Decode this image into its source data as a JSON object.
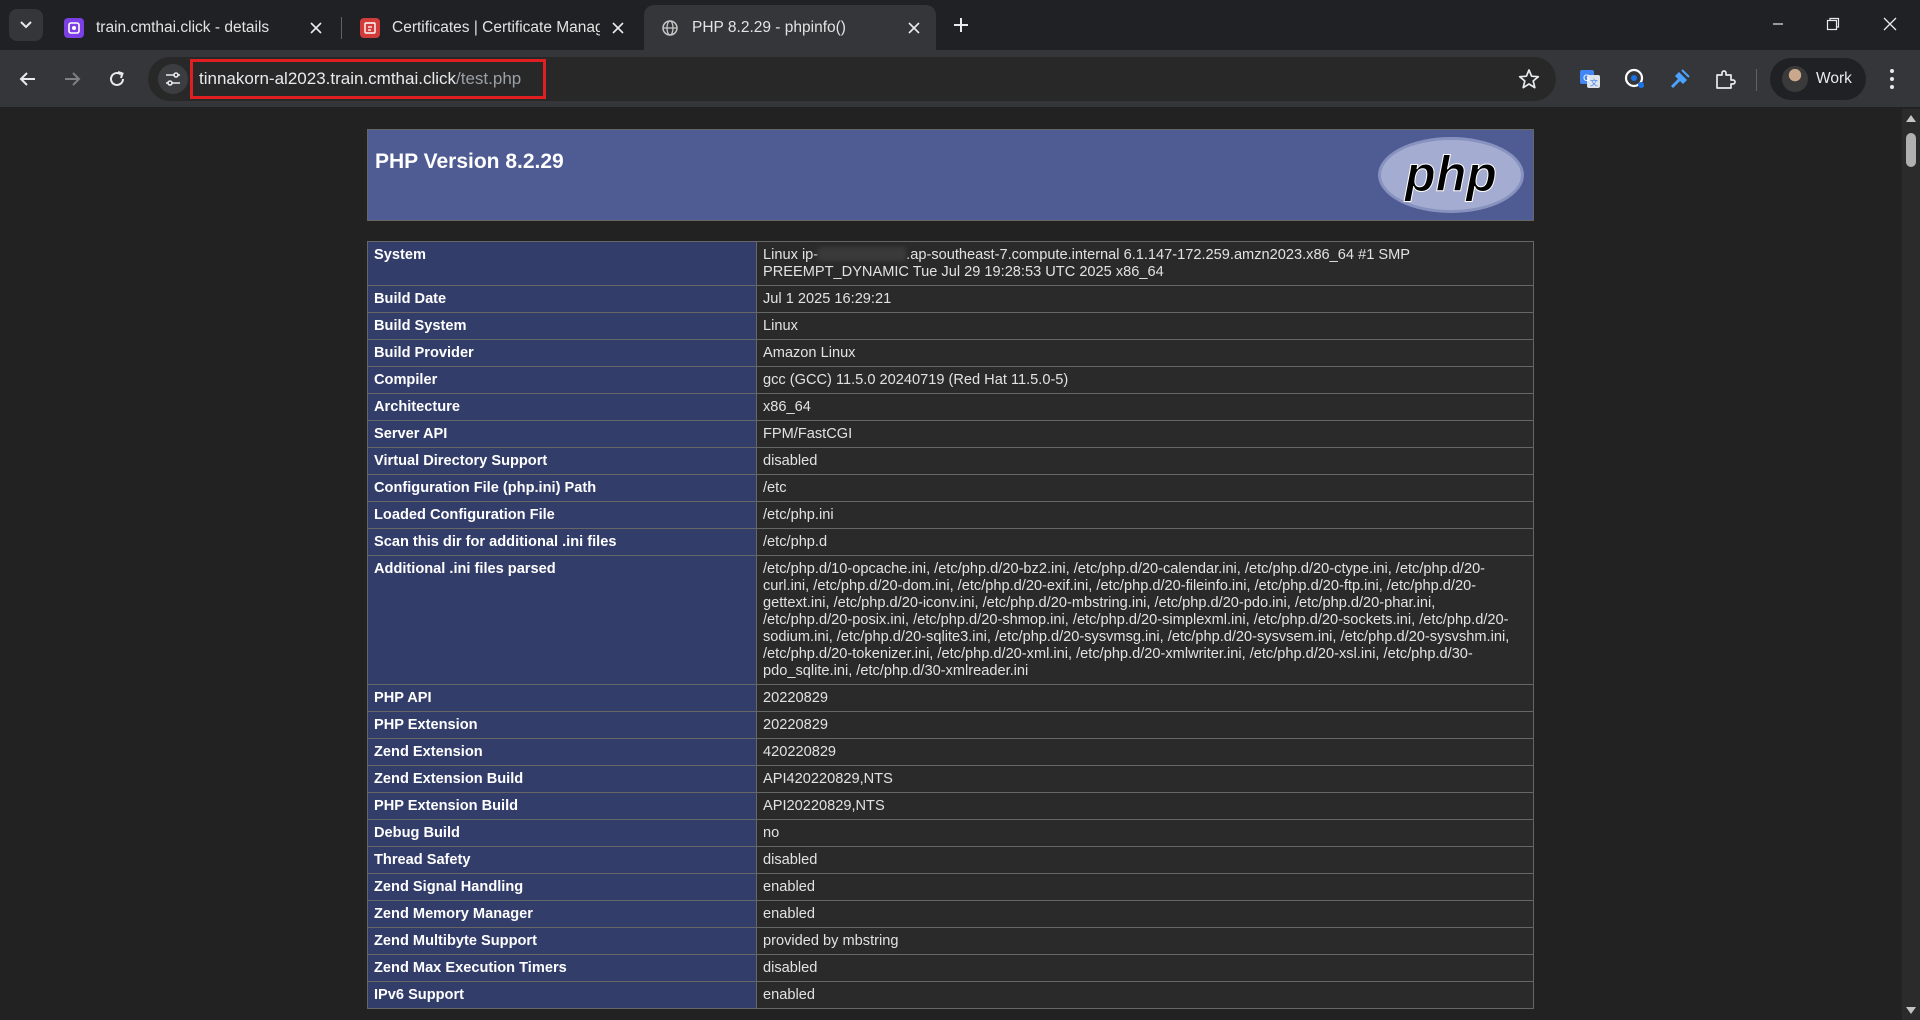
{
  "browser": {
    "tabs": [
      {
        "title": "train.cmthai.click - details",
        "icon": "purple-app-icon",
        "active": false
      },
      {
        "title": "Certificates | Certificate Manager",
        "icon": "certificate-manager-icon",
        "active": false
      },
      {
        "title": "PHP 8.2.29 - phpinfo()",
        "icon": "globe-icon",
        "active": true
      }
    ],
    "address": {
      "host": "tinnakorn-al2023.train.cmthai.click",
      "path": "/test.php"
    },
    "profile_label": "Work",
    "colors": {
      "highlight_box": "#e02020",
      "php_header": "#4f5b93",
      "label_cell": "#333d6a"
    }
  },
  "phpinfo": {
    "version_title": "PHP Version 8.2.29",
    "logo_text": "php",
    "rows": [
      {
        "key": "System",
        "value_prefix": "Linux ip-",
        "value_suffix": ".ap-southeast-7.compute.internal 6.1.147-172.259.amzn2023.x86_64 #1 SMP PREEMPT_DYNAMIC Tue Jul 29 19:28:53 UTC 2025 x86_64"
      },
      {
        "key": "Build Date",
        "value": "Jul 1 2025 16:29:21"
      },
      {
        "key": "Build System",
        "value": "Linux"
      },
      {
        "key": "Build Provider",
        "value": "Amazon Linux"
      },
      {
        "key": "Compiler",
        "value": "gcc (GCC) 11.5.0 20240719 (Red Hat 11.5.0-5)"
      },
      {
        "key": "Architecture",
        "value": "x86_64"
      },
      {
        "key": "Server API",
        "value": "FPM/FastCGI"
      },
      {
        "key": "Virtual Directory Support",
        "value": "disabled"
      },
      {
        "key": "Configuration File (php.ini) Path",
        "value": "/etc"
      },
      {
        "key": "Loaded Configuration File",
        "value": "/etc/php.ini"
      },
      {
        "key": "Scan this dir for additional .ini files",
        "value": "/etc/php.d"
      },
      {
        "key": "Additional .ini files parsed",
        "value": "/etc/php.d/10-opcache.ini, /etc/php.d/20-bz2.ini, /etc/php.d/20-calendar.ini, /etc/php.d/20-ctype.ini, /etc/php.d/20-curl.ini, /etc/php.d/20-dom.ini, /etc/php.d/20-exif.ini, /etc/php.d/20-fileinfo.ini, /etc/php.d/20-ftp.ini, /etc/php.d/20-gettext.ini, /etc/php.d/20-iconv.ini, /etc/php.d/20-mbstring.ini, /etc/php.d/20-pdo.ini, /etc/php.d/20-phar.ini, /etc/php.d/20-posix.ini, /etc/php.d/20-shmop.ini, /etc/php.d/20-simplexml.ini, /etc/php.d/20-sockets.ini, /etc/php.d/20-sodium.ini, /etc/php.d/20-sqlite3.ini, /etc/php.d/20-sysvmsg.ini, /etc/php.d/20-sysvsem.ini, /etc/php.d/20-sysvshm.ini, /etc/php.d/20-tokenizer.ini, /etc/php.d/20-xml.ini, /etc/php.d/20-xmlwriter.ini, /etc/php.d/20-xsl.ini, /etc/php.d/30-pdo_sqlite.ini, /etc/php.d/30-xmlreader.ini"
      },
      {
        "key": "PHP API",
        "value": "20220829"
      },
      {
        "key": "PHP Extension",
        "value": "20220829"
      },
      {
        "key": "Zend Extension",
        "value": "420220829"
      },
      {
        "key": "Zend Extension Build",
        "value": "API420220829,NTS"
      },
      {
        "key": "PHP Extension Build",
        "value": "API20220829,NTS"
      },
      {
        "key": "Debug Build",
        "value": "no"
      },
      {
        "key": "Thread Safety",
        "value": "disabled"
      },
      {
        "key": "Zend Signal Handling",
        "value": "enabled"
      },
      {
        "key": "Zend Memory Manager",
        "value": "enabled"
      },
      {
        "key": "Zend Multibyte Support",
        "value": "provided by mbstring"
      },
      {
        "key": "Zend Max Execution Timers",
        "value": "disabled"
      },
      {
        "key": "IPv6 Support",
        "value": "enabled"
      }
    ]
  }
}
